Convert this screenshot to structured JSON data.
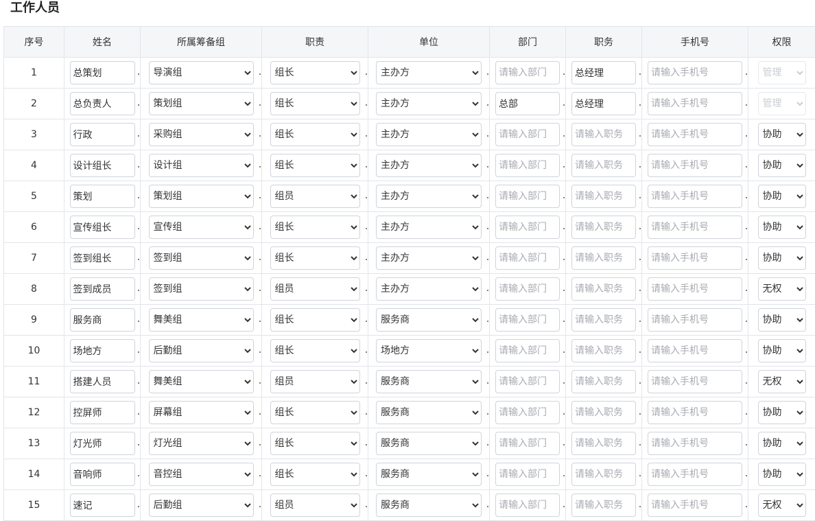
{
  "page_title": "工作人员",
  "columns": [
    "序号",
    "姓名",
    "所属筹备组",
    "职责",
    "单位",
    "部门",
    "职务",
    "手机号",
    "权限"
  ],
  "placeholders": {
    "dept": "请输入部门",
    "post": "请输入职务",
    "phone": "请输入手机号"
  },
  "rows": [
    {
      "no": "1",
      "name": "总策划",
      "group": "导演组",
      "duty": "组长",
      "unit": "主办方",
      "dept": "",
      "post": "总经理",
      "phone": "",
      "perm": "管理",
      "perm_disabled": true
    },
    {
      "no": "2",
      "name": "总负责人",
      "group": "策划组",
      "duty": "组长",
      "unit": "主办方",
      "dept": "总部",
      "post": "总经理",
      "phone": "",
      "perm": "管理",
      "perm_disabled": true
    },
    {
      "no": "3",
      "name": "行政",
      "group": "采购组",
      "duty": "组长",
      "unit": "主办方",
      "dept": "",
      "post": "",
      "phone": "",
      "perm": "协助",
      "perm_disabled": false
    },
    {
      "no": "4",
      "name": "设计组长",
      "group": "设计组",
      "duty": "组长",
      "unit": "主办方",
      "dept": "",
      "post": "",
      "phone": "",
      "perm": "协助",
      "perm_disabled": false
    },
    {
      "no": "5",
      "name": "策划",
      "group": "策划组",
      "duty": "组员",
      "unit": "主办方",
      "dept": "",
      "post": "",
      "phone": "",
      "perm": "协助",
      "perm_disabled": false
    },
    {
      "no": "6",
      "name": "宣传组长",
      "group": "宣传组",
      "duty": "组长",
      "unit": "主办方",
      "dept": "",
      "post": "",
      "phone": "",
      "perm": "协助",
      "perm_disabled": false
    },
    {
      "no": "7",
      "name": "签到组长",
      "group": "签到组",
      "duty": "组长",
      "unit": "主办方",
      "dept": "",
      "post": "",
      "phone": "",
      "perm": "协助",
      "perm_disabled": false
    },
    {
      "no": "8",
      "name": "签到成员",
      "group": "签到组",
      "duty": "组员",
      "unit": "主办方",
      "dept": "",
      "post": "",
      "phone": "",
      "perm": "无权",
      "perm_disabled": false
    },
    {
      "no": "9",
      "name": "服务商",
      "group": "舞美组",
      "duty": "组长",
      "unit": "服务商",
      "dept": "",
      "post": "",
      "phone": "",
      "perm": "协助",
      "perm_disabled": false
    },
    {
      "no": "10",
      "name": "场地方",
      "group": "后勤组",
      "duty": "组长",
      "unit": "场地方",
      "dept": "",
      "post": "",
      "phone": "",
      "perm": "协助",
      "perm_disabled": false
    },
    {
      "no": "11",
      "name": "搭建人员",
      "group": "舞美组",
      "duty": "组员",
      "unit": "服务商",
      "dept": "",
      "post": "",
      "phone": "",
      "perm": "无权",
      "perm_disabled": false
    },
    {
      "no": "12",
      "name": "控屏师",
      "group": "屏幕组",
      "duty": "组长",
      "unit": "服务商",
      "dept": "",
      "post": "",
      "phone": "",
      "perm": "协助",
      "perm_disabled": false
    },
    {
      "no": "13",
      "name": "灯光师",
      "group": "灯光组",
      "duty": "组长",
      "unit": "服务商",
      "dept": "",
      "post": "",
      "phone": "",
      "perm": "协助",
      "perm_disabled": false
    },
    {
      "no": "14",
      "name": "音响师",
      "group": "音控组",
      "duty": "组长",
      "unit": "服务商",
      "dept": "",
      "post": "",
      "phone": "",
      "perm": "协助",
      "perm_disabled": false
    },
    {
      "no": "15",
      "name": "速记",
      "group": "后勤组",
      "duty": "组员",
      "unit": "服务商",
      "dept": "",
      "post": "",
      "phone": "",
      "perm": "无权",
      "perm_disabled": false
    }
  ]
}
